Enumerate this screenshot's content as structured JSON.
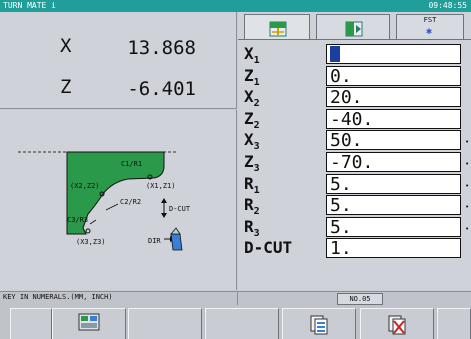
{
  "titlebar": {
    "app": "TURN MATE i",
    "clock": "09:48:55"
  },
  "coords": [
    {
      "axis": "X",
      "value": "13.868"
    },
    {
      "axis": "Z",
      "value": "-6.401"
    }
  ],
  "drawing": {
    "labels": {
      "c1r1": "C1/R1",
      "x2z2": "(X2,Z2)",
      "x1z1": "(X1,Z1)",
      "c2r2": "C2/R2",
      "dcut": "D-CUT",
      "c3r3": "C3/R3",
      "x3z3": "(X3,Z3)",
      "dir": "DIR"
    }
  },
  "tabs": {
    "fst": "FST"
  },
  "params": [
    {
      "label": "X",
      "sub": "1",
      "value": "",
      "active": true,
      "mark": false
    },
    {
      "label": "Z",
      "sub": "1",
      "value": "0.",
      "mark": false
    },
    {
      "label": "X",
      "sub": "2",
      "value": "20.",
      "mark": false
    },
    {
      "label": "Z",
      "sub": "2",
      "value": "-40.",
      "mark": false
    },
    {
      "label": "X",
      "sub": "3",
      "value": "50.",
      "mark": true
    },
    {
      "label": "Z",
      "sub": "3",
      "value": "-70.",
      "mark": true
    },
    {
      "label": "R",
      "sub": "1",
      "value": "5.",
      "mark": true
    },
    {
      "label": "R",
      "sub": "2",
      "value": "5.",
      "mark": true
    },
    {
      "label": "R",
      "sub": "3",
      "value": "5.",
      "mark": true
    },
    {
      "label": "D-CUT",
      "sub": "",
      "value": "1.",
      "mark": false
    }
  ],
  "status": {
    "message": "KEY IN NUMERALS.(MM, INCH)",
    "page": "NO.05"
  },
  "softkeys": [
    {
      "name": "softkey-1",
      "icon": ""
    },
    {
      "name": "softkey-2",
      "icon": "program-screen-icon"
    },
    {
      "name": "softkey-3",
      "icon": ""
    },
    {
      "name": "softkey-4",
      "icon": ""
    },
    {
      "name": "softkey-5",
      "icon": "insert-data-icon"
    },
    {
      "name": "softkey-6",
      "icon": "delete-data-icon"
    }
  ],
  "colors": {
    "titlebar": "#1f9e9a",
    "workpiece": "#2a9a4a",
    "cursor": "#1a3fa0"
  }
}
